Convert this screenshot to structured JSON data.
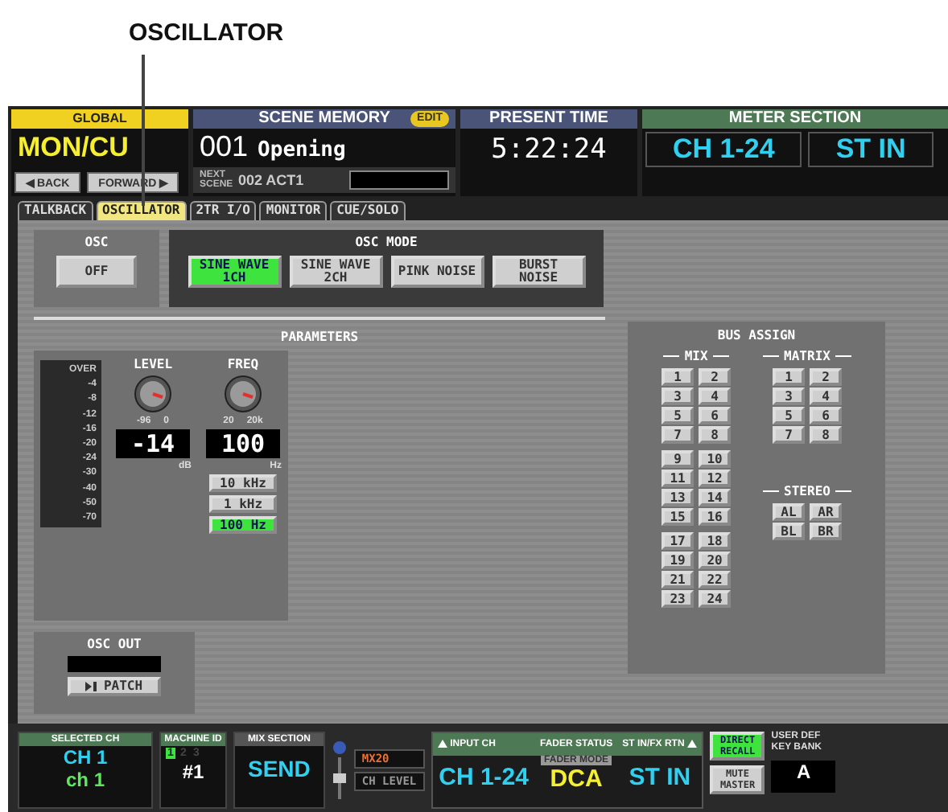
{
  "callout": {
    "label": "OSCILLATOR"
  },
  "header": {
    "global": {
      "title": "GLOBAL",
      "value": "MON/CU",
      "back": "◀ BACK",
      "forward": "FORWARD ▶"
    },
    "scene_memory": {
      "title": "SCENE MEMORY",
      "badge": "EDIT",
      "number": "001",
      "name": "Opening",
      "next_label": "NEXT SCENE",
      "next": "002 ACT1"
    },
    "present_time": {
      "title": "PRESENT TIME",
      "value": "5:22:24"
    },
    "meter_section": {
      "title": "METER SECTION",
      "buttons": [
        "CH 1-24",
        "ST IN"
      ]
    }
  },
  "tabs": [
    {
      "label": "TALKBACK",
      "selected": false
    },
    {
      "label": "OSCILLATOR",
      "selected": true
    },
    {
      "label": "2TR I/O",
      "selected": false
    },
    {
      "label": "MONITOR",
      "selected": false
    },
    {
      "label": "CUE/SOLO",
      "selected": false
    }
  ],
  "osc": {
    "title": "OSC",
    "button": {
      "label": "OFF",
      "on": false
    }
  },
  "osc_mode": {
    "title": "OSC MODE",
    "options": [
      {
        "label": "SINE WAVE 1CH",
        "selected": true
      },
      {
        "label": "SINE WAVE 2CH",
        "selected": false
      },
      {
        "label": "PINK NOISE",
        "selected": false
      },
      {
        "label": "BURST NOISE",
        "selected": false
      }
    ]
  },
  "parameters": {
    "title": "PARAMETERS",
    "meter_scale": [
      "OVER",
      "-4",
      "-8",
      "-12",
      "-16",
      "-20",
      "-24",
      "-30",
      "-40",
      "-50",
      "-70"
    ],
    "level": {
      "label": "LEVEL",
      "min": "-96",
      "max": "0",
      "value": "-14",
      "unit": "dB"
    },
    "freq": {
      "label": "FREQ",
      "min": "20",
      "max": "20k",
      "value": "100",
      "unit": "Hz",
      "presets": [
        {
          "label": "10 kHz",
          "selected": false
        },
        {
          "label": "1 kHz",
          "selected": false
        },
        {
          "label": "100 Hz",
          "selected": true
        }
      ]
    }
  },
  "osc_out": {
    "title": "OSC OUT",
    "patch": "PATCH"
  },
  "bus_assign": {
    "title": "BUS ASSIGN",
    "mix": {
      "title": "MIX",
      "buttons": [
        "1",
        "2",
        "3",
        "4",
        "5",
        "6",
        "7",
        "8",
        "9",
        "10",
        "11",
        "12",
        "13",
        "14",
        "15",
        "16",
        "17",
        "18",
        "19",
        "20",
        "21",
        "22",
        "23",
        "24"
      ]
    },
    "matrix": {
      "title": "MATRIX",
      "buttons": [
        "1",
        "2",
        "3",
        "4",
        "5",
        "6",
        "7",
        "8"
      ]
    },
    "stereo": {
      "title": "STEREO",
      "buttons": [
        "AL",
        "AR",
        "BL",
        "BR"
      ]
    }
  },
  "status_bar": {
    "selected_ch": {
      "title": "SELECTED CH",
      "value": "CH 1",
      "name": "ch 1"
    },
    "machine_id": {
      "title": "MACHINE ID",
      "slots": [
        {
          "label": "1",
          "selected": true
        },
        {
          "label": "2",
          "selected": false
        },
        {
          "label": "3",
          "selected": false
        }
      ],
      "value": "#1"
    },
    "mix_section": {
      "title": "MIX SECTION",
      "value": "SEND"
    },
    "mix_select": {
      "bus": "MX20",
      "ch_level": "CH LEVEL"
    },
    "fader_status": {
      "input_ch": "INPUT CH",
      "title": "FADER STATUS",
      "st": "ST IN/FX RTN",
      "input_value": "CH 1-24",
      "mode_label": "FADER MODE",
      "mode": "DCA",
      "st_value": "ST IN"
    },
    "direct_recall": {
      "label": "DIRECT RECALL",
      "on": true
    },
    "mute_master": {
      "label": "MUTE MASTER",
      "on": false
    },
    "user_def": {
      "title": "USER DEF KEY BANK",
      "value": "A"
    }
  }
}
